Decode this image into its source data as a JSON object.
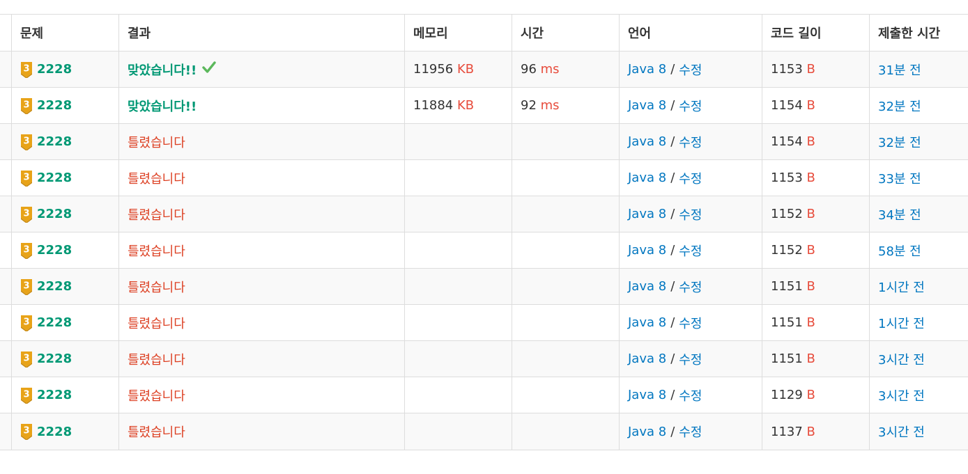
{
  "headers": [
    "문제",
    "결과",
    "메모리",
    "시간",
    "언어",
    "코드 길이",
    "제출한 시간"
  ],
  "rows": [
    {
      "problem": "2228",
      "tier": "3",
      "result": "맞았습니다!!",
      "accepted": true,
      "check": true,
      "memory": "11956",
      "memory_unit": "KB",
      "time": "96",
      "time_unit": "ms",
      "language": "Java 8",
      "separator": "/",
      "edit": "수정",
      "code_length": "1153",
      "code_unit": "B",
      "submitted": "31분 전"
    },
    {
      "problem": "2228",
      "tier": "3",
      "result": "맞았습니다!!",
      "accepted": true,
      "check": false,
      "memory": "11884",
      "memory_unit": "KB",
      "time": "92",
      "time_unit": "ms",
      "language": "Java 8",
      "separator": "/",
      "edit": "수정",
      "code_length": "1154",
      "code_unit": "B",
      "submitted": "32분 전"
    },
    {
      "problem": "2228",
      "tier": "3",
      "result": "틀렸습니다",
      "accepted": false,
      "check": false,
      "memory": "",
      "memory_unit": "",
      "time": "",
      "time_unit": "",
      "language": "Java 8",
      "separator": "/",
      "edit": "수정",
      "code_length": "1154",
      "code_unit": "B",
      "submitted": "32분 전"
    },
    {
      "problem": "2228",
      "tier": "3",
      "result": "틀렸습니다",
      "accepted": false,
      "check": false,
      "memory": "",
      "memory_unit": "",
      "time": "",
      "time_unit": "",
      "language": "Java 8",
      "separator": "/",
      "edit": "수정",
      "code_length": "1153",
      "code_unit": "B",
      "submitted": "33분 전"
    },
    {
      "problem": "2228",
      "tier": "3",
      "result": "틀렸습니다",
      "accepted": false,
      "check": false,
      "memory": "",
      "memory_unit": "",
      "time": "",
      "time_unit": "",
      "language": "Java 8",
      "separator": "/",
      "edit": "수정",
      "code_length": "1152",
      "code_unit": "B",
      "submitted": "34분 전"
    },
    {
      "problem": "2228",
      "tier": "3",
      "result": "틀렸습니다",
      "accepted": false,
      "check": false,
      "memory": "",
      "memory_unit": "",
      "time": "",
      "time_unit": "",
      "language": "Java 8",
      "separator": "/",
      "edit": "수정",
      "code_length": "1152",
      "code_unit": "B",
      "submitted": "58분 전"
    },
    {
      "problem": "2228",
      "tier": "3",
      "result": "틀렸습니다",
      "accepted": false,
      "check": false,
      "memory": "",
      "memory_unit": "",
      "time": "",
      "time_unit": "",
      "language": "Java 8",
      "separator": "/",
      "edit": "수정",
      "code_length": "1151",
      "code_unit": "B",
      "submitted": "1시간 전"
    },
    {
      "problem": "2228",
      "tier": "3",
      "result": "틀렸습니다",
      "accepted": false,
      "check": false,
      "memory": "",
      "memory_unit": "",
      "time": "",
      "time_unit": "",
      "language": "Java 8",
      "separator": "/",
      "edit": "수정",
      "code_length": "1151",
      "code_unit": "B",
      "submitted": "1시간 전"
    },
    {
      "problem": "2228",
      "tier": "3",
      "result": "틀렸습니다",
      "accepted": false,
      "check": false,
      "memory": "",
      "memory_unit": "",
      "time": "",
      "time_unit": "",
      "language": "Java 8",
      "separator": "/",
      "edit": "수정",
      "code_length": "1151",
      "code_unit": "B",
      "submitted": "3시간 전"
    },
    {
      "problem": "2228",
      "tier": "3",
      "result": "틀렸습니다",
      "accepted": false,
      "check": false,
      "memory": "",
      "memory_unit": "",
      "time": "",
      "time_unit": "",
      "language": "Java 8",
      "separator": "/",
      "edit": "수정",
      "code_length": "1129",
      "code_unit": "B",
      "submitted": "3시간 전"
    },
    {
      "problem": "2228",
      "tier": "3",
      "result": "틀렸습니다",
      "accepted": false,
      "check": false,
      "memory": "",
      "memory_unit": "",
      "time": "",
      "time_unit": "",
      "language": "Java 8",
      "separator": "/",
      "edit": "수정",
      "code_length": "1137",
      "code_unit": "B",
      "submitted": "3시간 전"
    }
  ],
  "colors": {
    "accepted": "#009874",
    "wrong": "#dd4124",
    "link": "#0076c0",
    "unit": "#e74c3c",
    "badge": "#e8a318",
    "check": "#5cb85c"
  },
  "icons": {
    "tier_badge": "gold-tier-3-badge-icon",
    "accepted_check": "checkmark-icon"
  }
}
